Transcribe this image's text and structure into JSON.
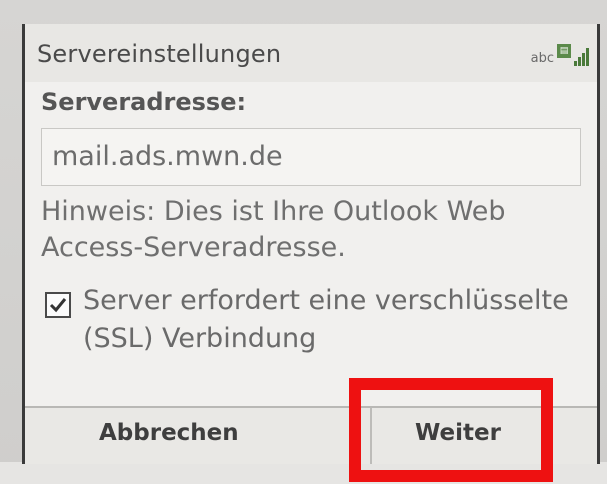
{
  "title": "Servereinstellungen",
  "status": {
    "input_mode": "abc",
    "signal_bars": 4
  },
  "form": {
    "label": "Serveradresse:",
    "server_address": "mail.ads.mwn.de",
    "hint": "Hinweis: Dies ist Ihre Outlook Web Access-Serveradresse.",
    "ssl_checked": true,
    "ssl_label": "Server erfordert eine verschlüsselte (SSL) Verbindung"
  },
  "softkeys": {
    "left": "Abbrechen",
    "right": "Weiter"
  },
  "colors": {
    "highlight": "#ee1111",
    "screen_bg": "#f1f0ee",
    "text": "#6a6a6a"
  }
}
